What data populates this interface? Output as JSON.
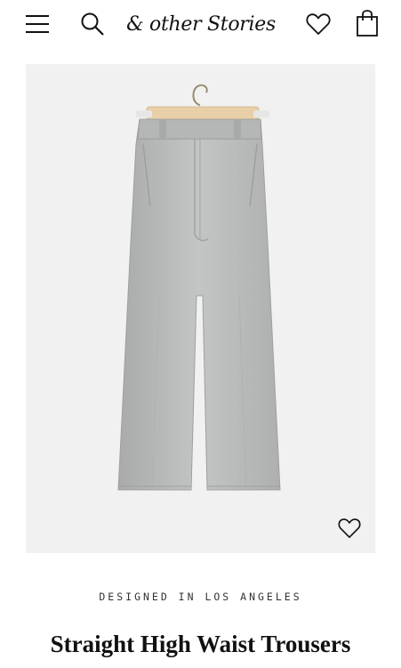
{
  "header": {
    "logo_text": "& other Stories",
    "icons": {
      "menu": "hamburger-menu-icon",
      "search": "search-icon",
      "wishlist": "heart-icon",
      "bag": "shopping-bag-icon"
    }
  },
  "product": {
    "image_description_icon": "product-photo",
    "wishlist_icon": "heart-icon",
    "tagline": "DESIGNED IN LOS ANGELES",
    "title": "Straight High Waist Trousers"
  },
  "colors": {
    "background": "#ffffff",
    "image_bg": "#f1f1f1",
    "trouser_fabric": "#b9bbbb",
    "hanger": "#e8cfa7",
    "text": "#111111"
  }
}
